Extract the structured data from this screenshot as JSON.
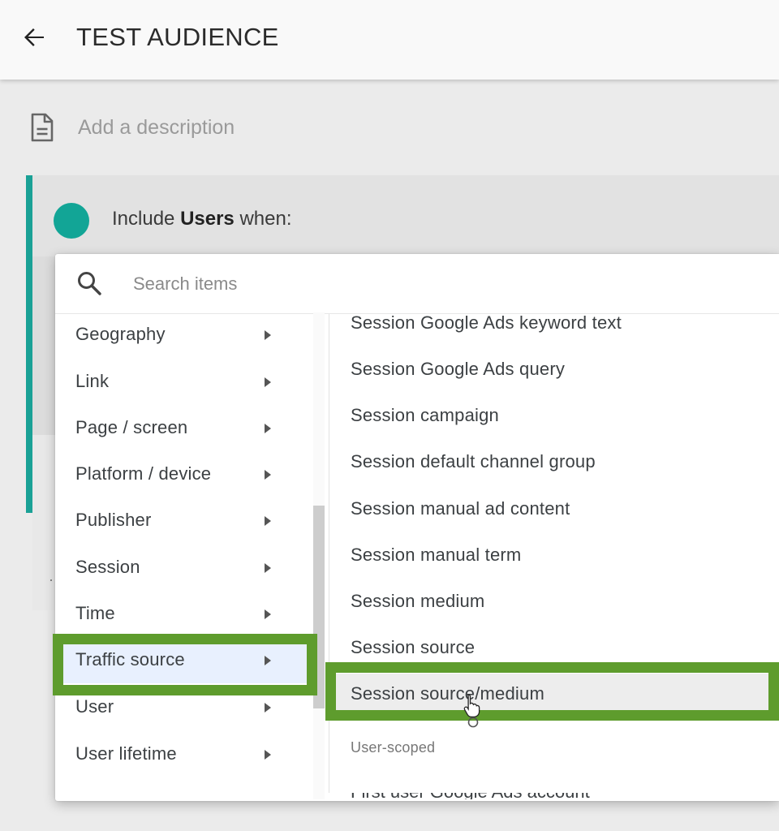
{
  "header": {
    "title": "TEST AUDIENCE",
    "back_icon": "arrow-back-icon"
  },
  "description": {
    "placeholder": "Add a description",
    "icon": "document-icon"
  },
  "condition": {
    "prefix": "Include ",
    "scope": "Users",
    "suffix": " when:",
    "accent_color": "#1aa196"
  },
  "menu": {
    "search": {
      "placeholder": "Search items",
      "icon": "search-icon"
    },
    "categories": [
      {
        "label": "Geography"
      },
      {
        "label": "Link"
      },
      {
        "label": "Page / screen"
      },
      {
        "label": "Platform / device"
      },
      {
        "label": "Publisher"
      },
      {
        "label": "Session"
      },
      {
        "label": "Time"
      },
      {
        "label": "Traffic source",
        "selected": true
      },
      {
        "label": "User"
      },
      {
        "label": "User lifetime"
      }
    ],
    "options": [
      {
        "label": "Session Google Ads keyword text"
      },
      {
        "label": "Session Google Ads query"
      },
      {
        "label": "Session campaign"
      },
      {
        "label": "Session default channel group"
      },
      {
        "label": "Session manual ad content"
      },
      {
        "label": "Session manual term"
      },
      {
        "label": "Session medium"
      },
      {
        "label": "Session source"
      },
      {
        "label": "Session source/medium",
        "hovered": true
      }
    ],
    "section_label": "User-scoped"
  },
  "highlight_color": "#5e9c2d"
}
